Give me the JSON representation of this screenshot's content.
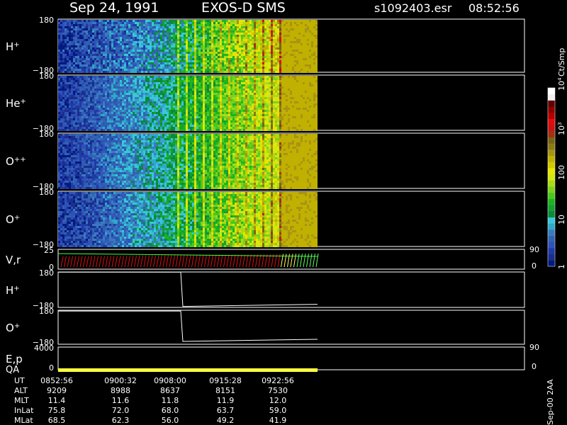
{
  "header": {
    "date": "Sep 24, 1991",
    "instrument": "EXOS-D SMS",
    "file": "s1092403.esr",
    "time": "08:52:56"
  },
  "chart_data": {
    "type": "heatmap",
    "panels": [
      {
        "label": "H",
        "sup": "+",
        "ytop": "180",
        "ybot": "−180",
        "kind": "spectrogram"
      },
      {
        "label": "He",
        "sup": "+",
        "ytop": "180",
        "ybot": "−180",
        "kind": "spectrogram"
      },
      {
        "label": "O",
        "sup": "++",
        "ytop": "180",
        "ybot": "−180",
        "kind": "spectrogram"
      },
      {
        "label": "O",
        "sup": "+",
        "ytop": "180",
        "ybot": "−180",
        "kind": "spectrogram"
      },
      {
        "label": "V,r",
        "sup": "",
        "ytop": "25",
        "ybot": "0",
        "kind": "vectors",
        "right_top": "90",
        "right_bot": "0"
      },
      {
        "label": "H",
        "sup": "+",
        "ytop": "180",
        "ybot": "−180",
        "kind": "line"
      },
      {
        "label": "O",
        "sup": "+",
        "ytop": "180",
        "ybot": "−180",
        "kind": "line"
      },
      {
        "label": "E,p",
        "sup": "",
        "ytop": "4000",
        "ybot": "0",
        "kind": "ep",
        "label2": "QA",
        "right_top": "90",
        "right_bot": "0"
      }
    ],
    "colorbar": {
      "title": "Ct/Smp",
      "ticks": [
        {
          "base": "1",
          "exp": "",
          "value": 1
        },
        {
          "base": "10",
          "exp": "",
          "value": 10
        },
        {
          "base": "100",
          "exp": "",
          "value": 100
        },
        {
          "base": "10",
          "exp": "3",
          "value": 1000
        },
        {
          "base": "10",
          "exp": "4",
          "value": 10000
        }
      ],
      "colors": [
        "#001a80",
        "#1a2e8c",
        "#203aa6",
        "#2e52b8",
        "#3064b0",
        "#3a7ac0",
        "#30a8c8",
        "#38c8d8",
        "#0a8a3a",
        "#14a032",
        "#1eb41e",
        "#4ac81e",
        "#7ad21e",
        "#a8dc14",
        "#d2e614",
        "#e6e600",
        "#d2c800",
        "#c0b000",
        "#a89414",
        "#8c7a14",
        "#7a6414",
        "#a03214",
        "#c81414",
        "#e60a0a",
        "#b40000",
        "#8c0000",
        "#640000",
        "#f0f0f0",
        "#ffffff"
      ]
    },
    "time_series": {
      "labels": [
        "UT",
        "ALT",
        "MLT",
        "InLat",
        "MLat"
      ],
      "columns": [
        [
          "0852:56",
          "9209",
          "11.4",
          "75.8",
          "68.5"
        ],
        [
          "0900:32",
          "8988",
          "11.6",
          "72.0",
          "62.3"
        ],
        [
          "0908:00",
          "8637",
          "11.8",
          "68.0",
          "56.0"
        ],
        [
          "0915:28",
          "8151",
          "11.9",
          "63.7",
          "49.2"
        ],
        [
          "0922:56",
          "7530",
          "12.0",
          "59.0",
          "41.9"
        ]
      ]
    },
    "line_panels": {
      "H+": {
        "before": 178,
        "after": -170
      },
      "O+": {
        "before": 172,
        "after": -150
      }
    },
    "footer_code": "Sep-00 2AA"
  }
}
